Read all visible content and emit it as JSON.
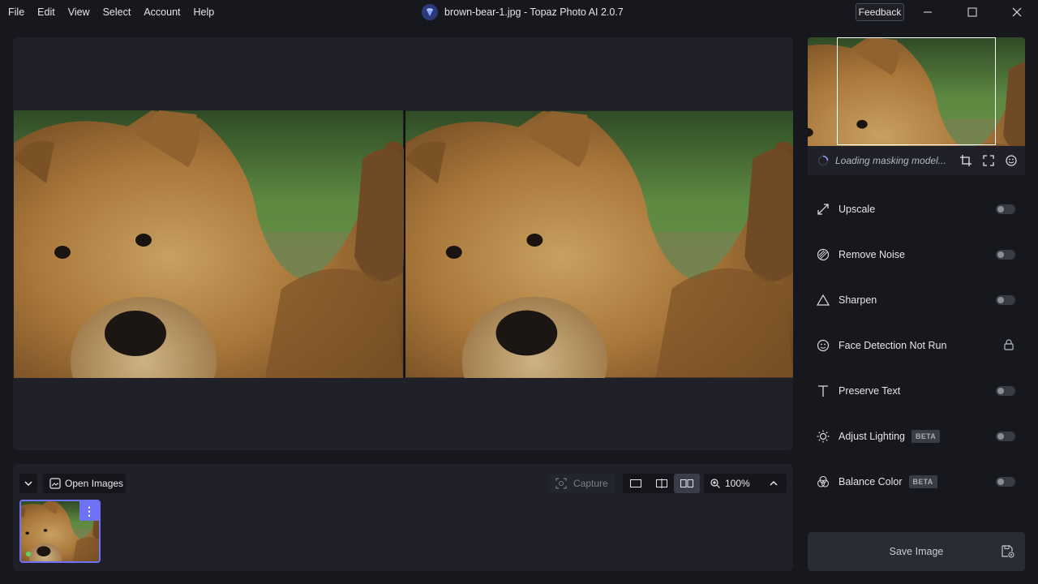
{
  "menu": {
    "items": [
      "File",
      "Edit",
      "View",
      "Select",
      "Account",
      "Help"
    ]
  },
  "window": {
    "title": "brown-bear-1.jpg - Topaz Photo AI 2.0.7",
    "feedback_label": "Feedback"
  },
  "icons": {
    "app": "topaz-diamond-icon",
    "minimize": "minimize-icon",
    "maximize": "maximize-icon",
    "close": "close-icon"
  },
  "colors": {
    "accent": "#6f72f5",
    "panel": "#1f2028",
    "background": "#17181d",
    "status_dot": "#5bd36b"
  },
  "navigator": {
    "status": "Loading masking model..."
  },
  "tools": [
    {
      "label": "Upscale",
      "icon": "upscale-icon",
      "beta": "",
      "enabled": false
    },
    {
      "label": "Remove Noise",
      "icon": "remove-noise-icon",
      "beta": "",
      "enabled": false
    },
    {
      "label": "Sharpen",
      "icon": "sharpen-icon",
      "beta": "",
      "enabled": false
    },
    {
      "label": "Face Detection Not Run",
      "icon": "face-icon",
      "beta": "",
      "locked": true
    },
    {
      "label": "Preserve Text",
      "icon": "text-icon",
      "beta": "",
      "enabled": false
    },
    {
      "label": "Adjust Lighting",
      "icon": "sun-icon",
      "beta": "BETA",
      "enabled": false
    },
    {
      "label": "Balance Color",
      "icon": "color-icon",
      "beta": "BETA",
      "enabled": false
    }
  ],
  "bottom": {
    "open_images_label": "Open Images",
    "capture_label": "Capture",
    "zoom": "100%",
    "active_view_mode": "side-by-side"
  },
  "save": {
    "label": "Save Image"
  }
}
